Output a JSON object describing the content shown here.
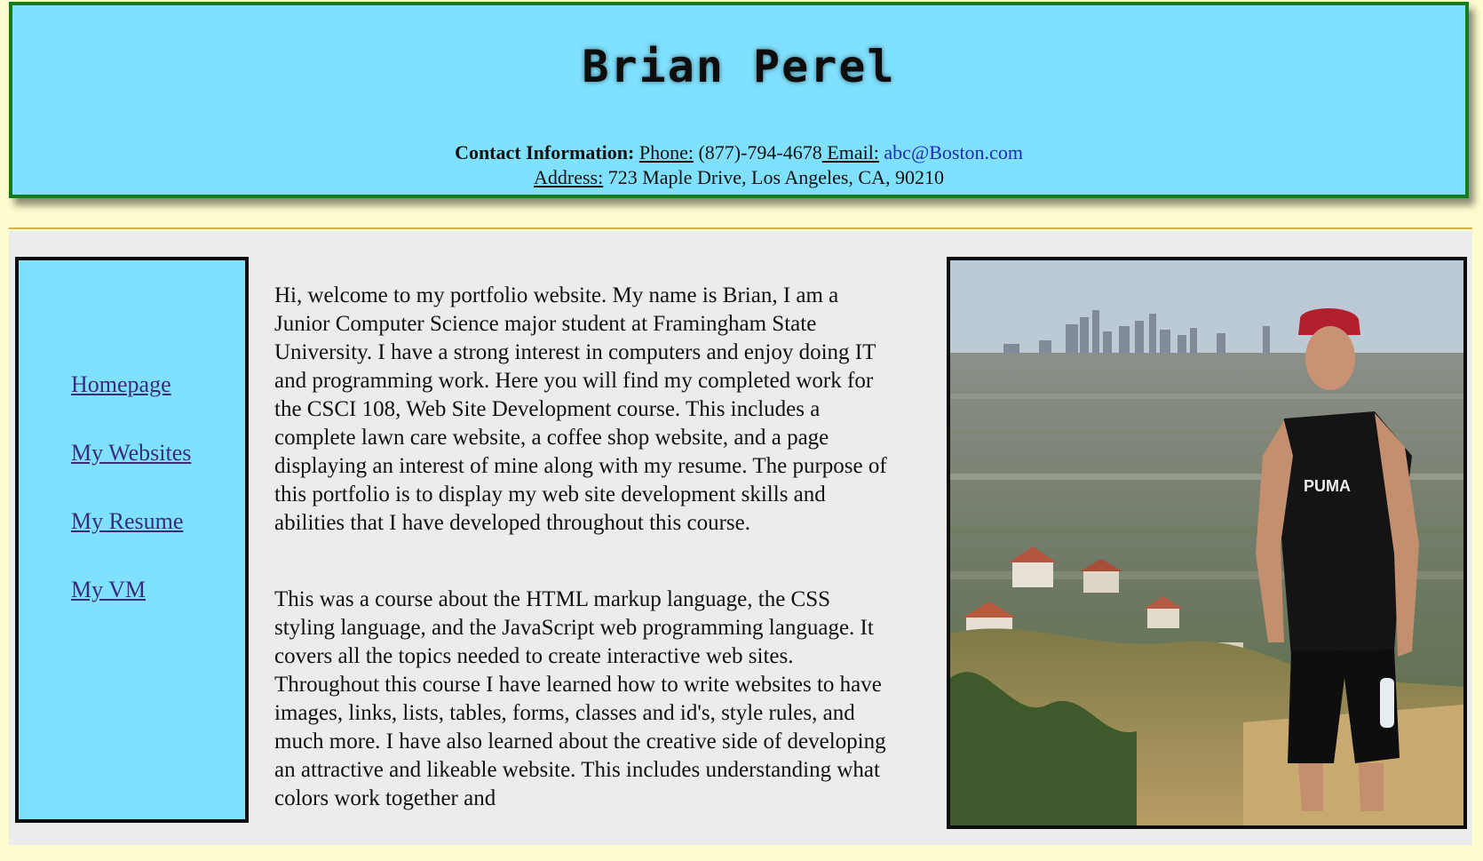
{
  "header": {
    "title": "Brian Perel",
    "contact_label": "Contact Information:",
    "phone_label": "Phone:",
    "phone_value": " (877)-794-4678",
    "email_label": " Email:",
    "email_value": "abc@Boston.com",
    "address_label": " Address:",
    "address_value": " 723 Maple Drive, Los Angeles, CA, 90210"
  },
  "nav": {
    "items": [
      {
        "label": "Homepage"
      },
      {
        "label": "My Websites"
      },
      {
        "label": "My Resume"
      },
      {
        "label": "My VM"
      }
    ]
  },
  "main": {
    "paragraphs": [
      "Hi, welcome to my portfolio website. My name is Brian, I am a Junior Computer Science major student at Framingham State University. I have a strong interest in computers and enjoy doing IT and programming work. Here you will find my completed work for the CSCI 108, Web Site Development course. This includes a complete lawn care website, a coffee shop website, and a page displaying an interest of mine along with my resume. The purpose of this portfolio is to display my web site development skills and abilities that I have developed throughout this course.",
      "This was a course about the HTML markup language, the CSS styling language, and the JavaScript web programming language. It covers all the topics needed to create interactive web sites. Throughout this course I have learned how to write websites to have images, links, lists, tables, forms, classes and id's, style rules, and much more. I have also learned about the creative side of developing an attractive and likeable website. This includes understanding what colors work together and"
    ]
  },
  "photo": {
    "shirt_logo": "PUMA"
  },
  "colors": {
    "header_bg": "#80e1ff",
    "header_border": "#137d1d",
    "page_bg": "#fdfccf",
    "content_bg": "#ececec",
    "link": "#3b2b7f",
    "email_link": "#1d2bb8",
    "separator": "#d8b24a"
  }
}
